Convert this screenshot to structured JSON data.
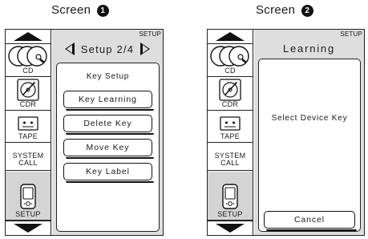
{
  "captions": [
    {
      "label": "Screen",
      "number": "1"
    },
    {
      "label": "Screen",
      "number": "2"
    }
  ],
  "sources": {
    "cd": "CD",
    "cdr": "CDR",
    "tape": "TAPE",
    "system_call_line1": "SYSTEM",
    "system_call_line2": "CALL",
    "setup": "SETUP"
  },
  "screen1": {
    "corner_label": "SETUP",
    "title": "Setup 2/4",
    "heading": "Key Setup",
    "buttons": [
      "Key Learning",
      "Delete Key",
      "Move Key",
      "Key Label"
    ]
  },
  "screen2": {
    "corner_label": "SETUP",
    "title": "Learning",
    "message": "Select Device Key",
    "cancel": "Cancel"
  },
  "colors": {
    "panel_bg": "#dedede",
    "active_source_bg": "#d4d4d4",
    "stroke": "#111111"
  },
  "icons": [
    "scroll-up-icon",
    "cd-icon",
    "cdr-icon",
    "tape-icon",
    "remote-icon",
    "scroll-down-icon",
    "arrow-left-icon",
    "arrow-right-icon"
  ]
}
